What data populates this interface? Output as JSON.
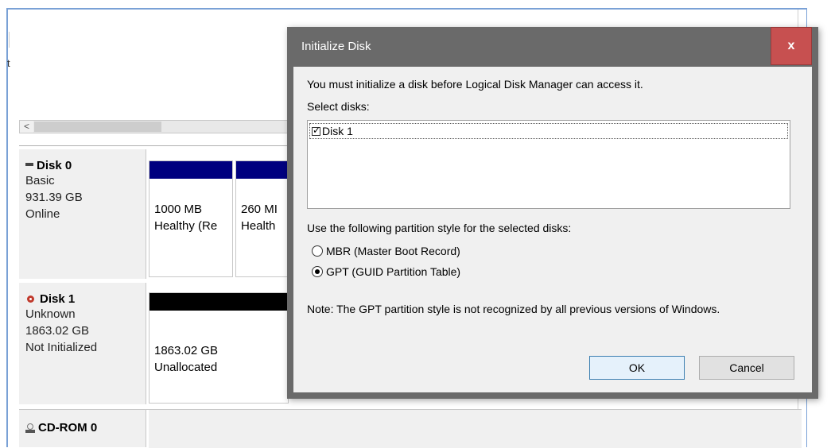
{
  "main": {
    "scroll_left_arrow": "<",
    "gutter_mark": "t"
  },
  "disks": [
    {
      "name": "Disk 0",
      "icon": "disk-icon",
      "type": "Basic",
      "size": "931.39 GB",
      "status": "Online",
      "partitions": [
        {
          "size": "1000 MB",
          "state": "Healthy (Re",
          "bar_color": "#00007f"
        },
        {
          "size": "260 MI",
          "state": "Health",
          "bar_color": "#00007f"
        }
      ]
    },
    {
      "name": "Disk 1",
      "icon": "unknown-disk-icon",
      "type": "Unknown",
      "size": "1863.02 GB",
      "status": "Not Initialized",
      "partitions": [
        {
          "size": "1863.02 GB",
          "state": "Unallocated",
          "bar_color": "#000000"
        }
      ]
    },
    {
      "name": "CD-ROM 0",
      "icon": "cdrom-icon"
    }
  ],
  "dialog": {
    "title": "Initialize Disk",
    "close_label": "x",
    "close_color": "#c75050",
    "intro": "You must initialize a disk before Logical Disk Manager can access it.",
    "select_label": "Select disks:",
    "disk_list": [
      {
        "label": "Disk 1",
        "checked": true
      }
    ],
    "partition_prompt": "Use the following partition style for the selected disks:",
    "options": [
      {
        "label": "MBR (Master Boot Record)",
        "selected": false
      },
      {
        "label": "GPT (GUID Partition Table)",
        "selected": true
      }
    ],
    "note": "Note: The GPT partition style is not recognized by all previous versions of Windows.",
    "ok_label": "OK",
    "cancel_label": "Cancel"
  }
}
